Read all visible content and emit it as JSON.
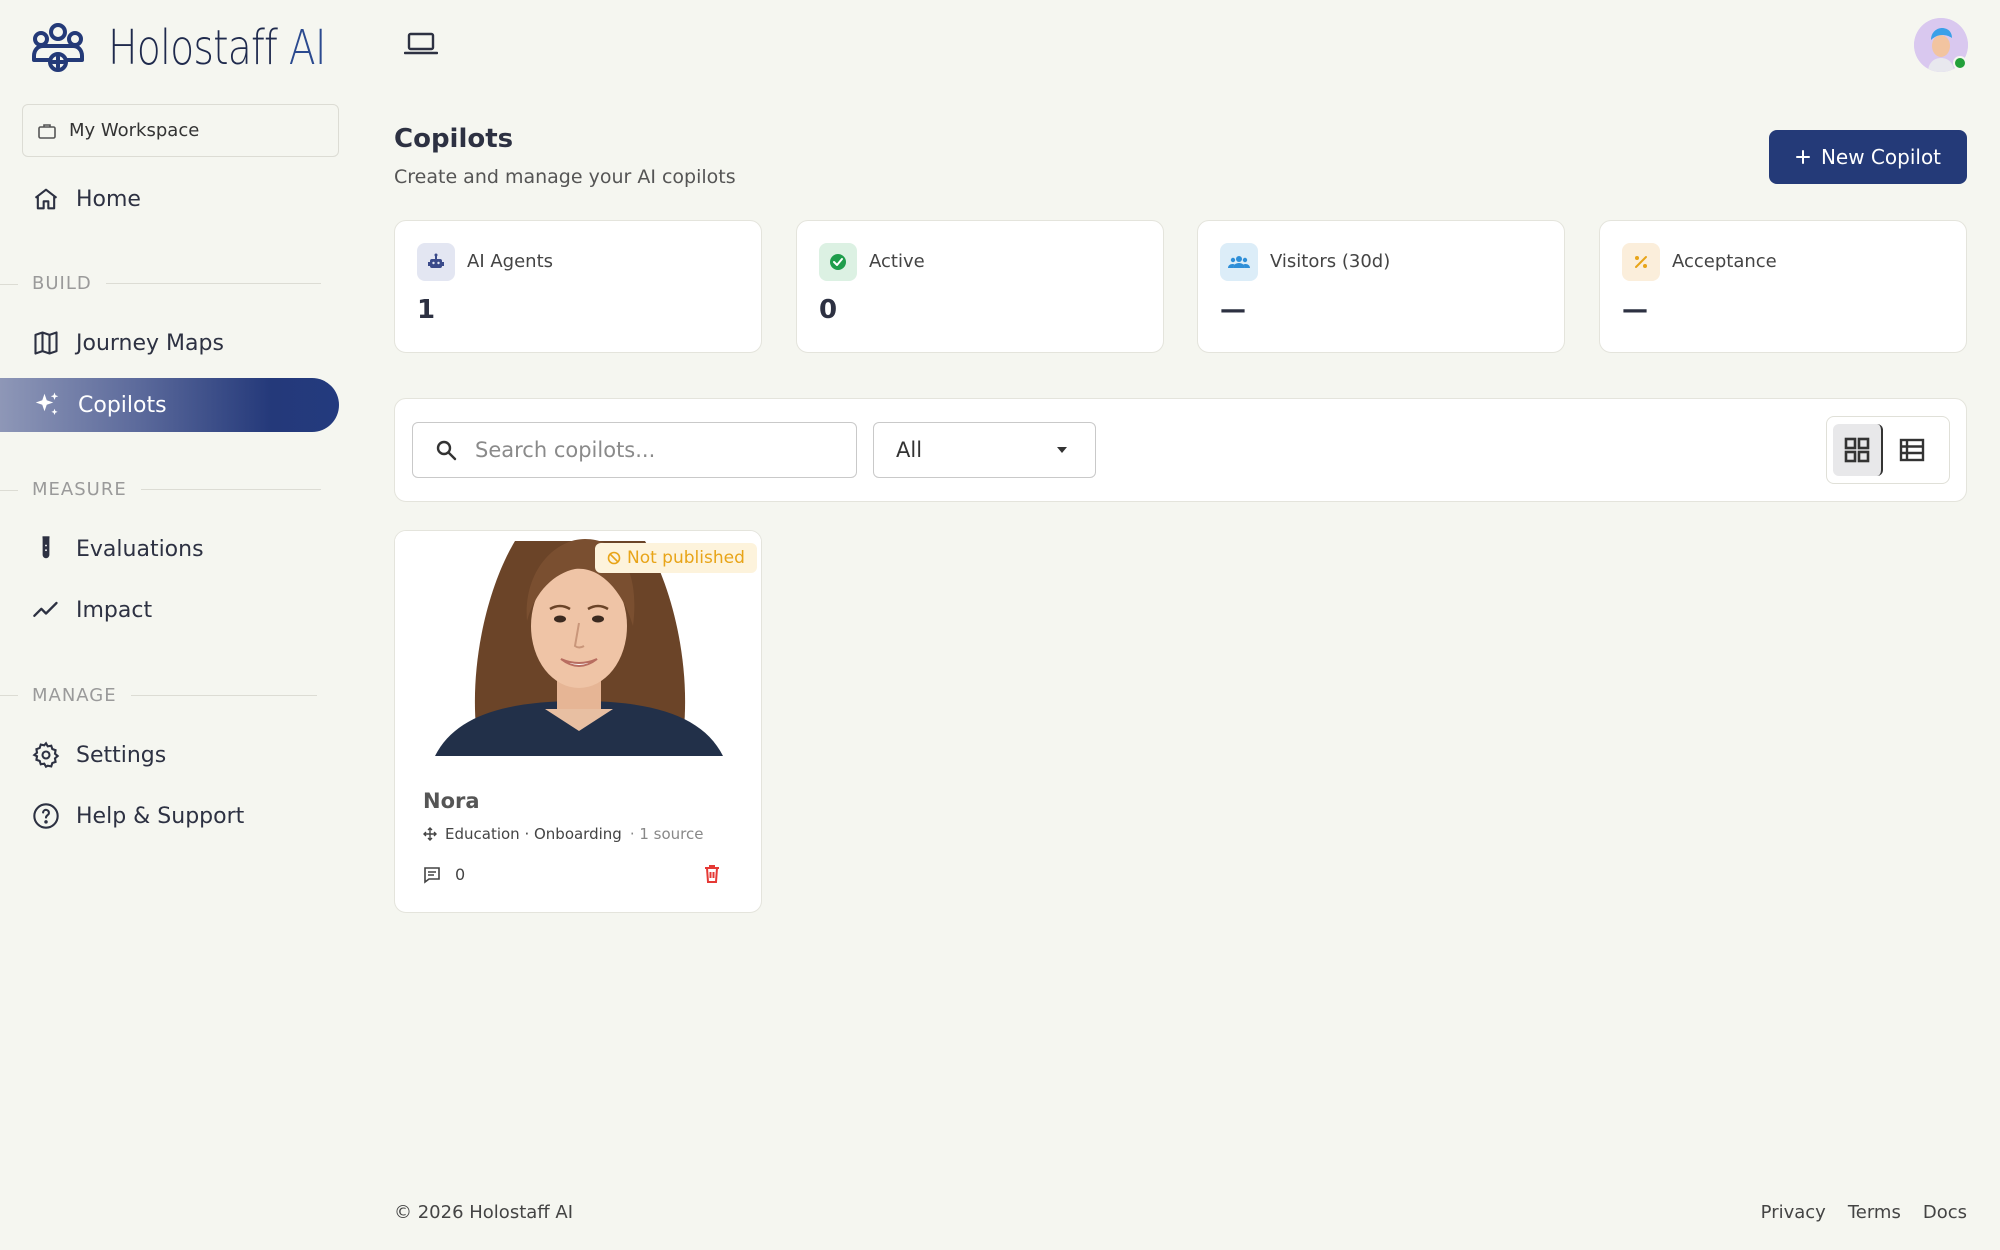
{
  "brand": {
    "name": "Holostaff",
    "suffix": "AI"
  },
  "workspace": {
    "label": "My Workspace"
  },
  "nav": {
    "home": "Home",
    "build_label": "BUILD",
    "journey_maps": "Journey Maps",
    "copilots": "Copilots",
    "measure_label": "MEASURE",
    "evaluations": "Evaluations",
    "impact": "Impact",
    "manage_label": "MANAGE",
    "settings": "Settings",
    "help": "Help & Support"
  },
  "page": {
    "title": "Copilots",
    "subtitle": "Create and manage your AI copilots",
    "new_button": "New Copilot"
  },
  "stats": [
    {
      "label": "AI Agents",
      "value": "1",
      "color": "#3a4a8a",
      "bg": "#e3e6f2"
    },
    {
      "label": "Active",
      "value": "0",
      "color": "#1f9d4c",
      "bg": "#dcf1e3"
    },
    {
      "label": "Visitors (30d)",
      "value": "—",
      "color": "#2f8fd8",
      "bg": "#dcedf8"
    },
    {
      "label": "Acceptance",
      "value": "—",
      "color": "#e8a418",
      "bg": "#fbeedb"
    }
  ],
  "filters": {
    "search_placeholder": "Search copilots...",
    "status_value": "All"
  },
  "copilots": [
    {
      "name": "Nora",
      "status": "Not published",
      "tags": "Education · Onboarding",
      "sources": "· 1 source",
      "conversations": "0"
    }
  ],
  "footer": {
    "copyright": "© 2026 Holostaff AI",
    "links": [
      "Privacy",
      "Terms",
      "Docs"
    ]
  },
  "colors": {
    "accent": "#243a78",
    "background": "#f5f6f0"
  }
}
